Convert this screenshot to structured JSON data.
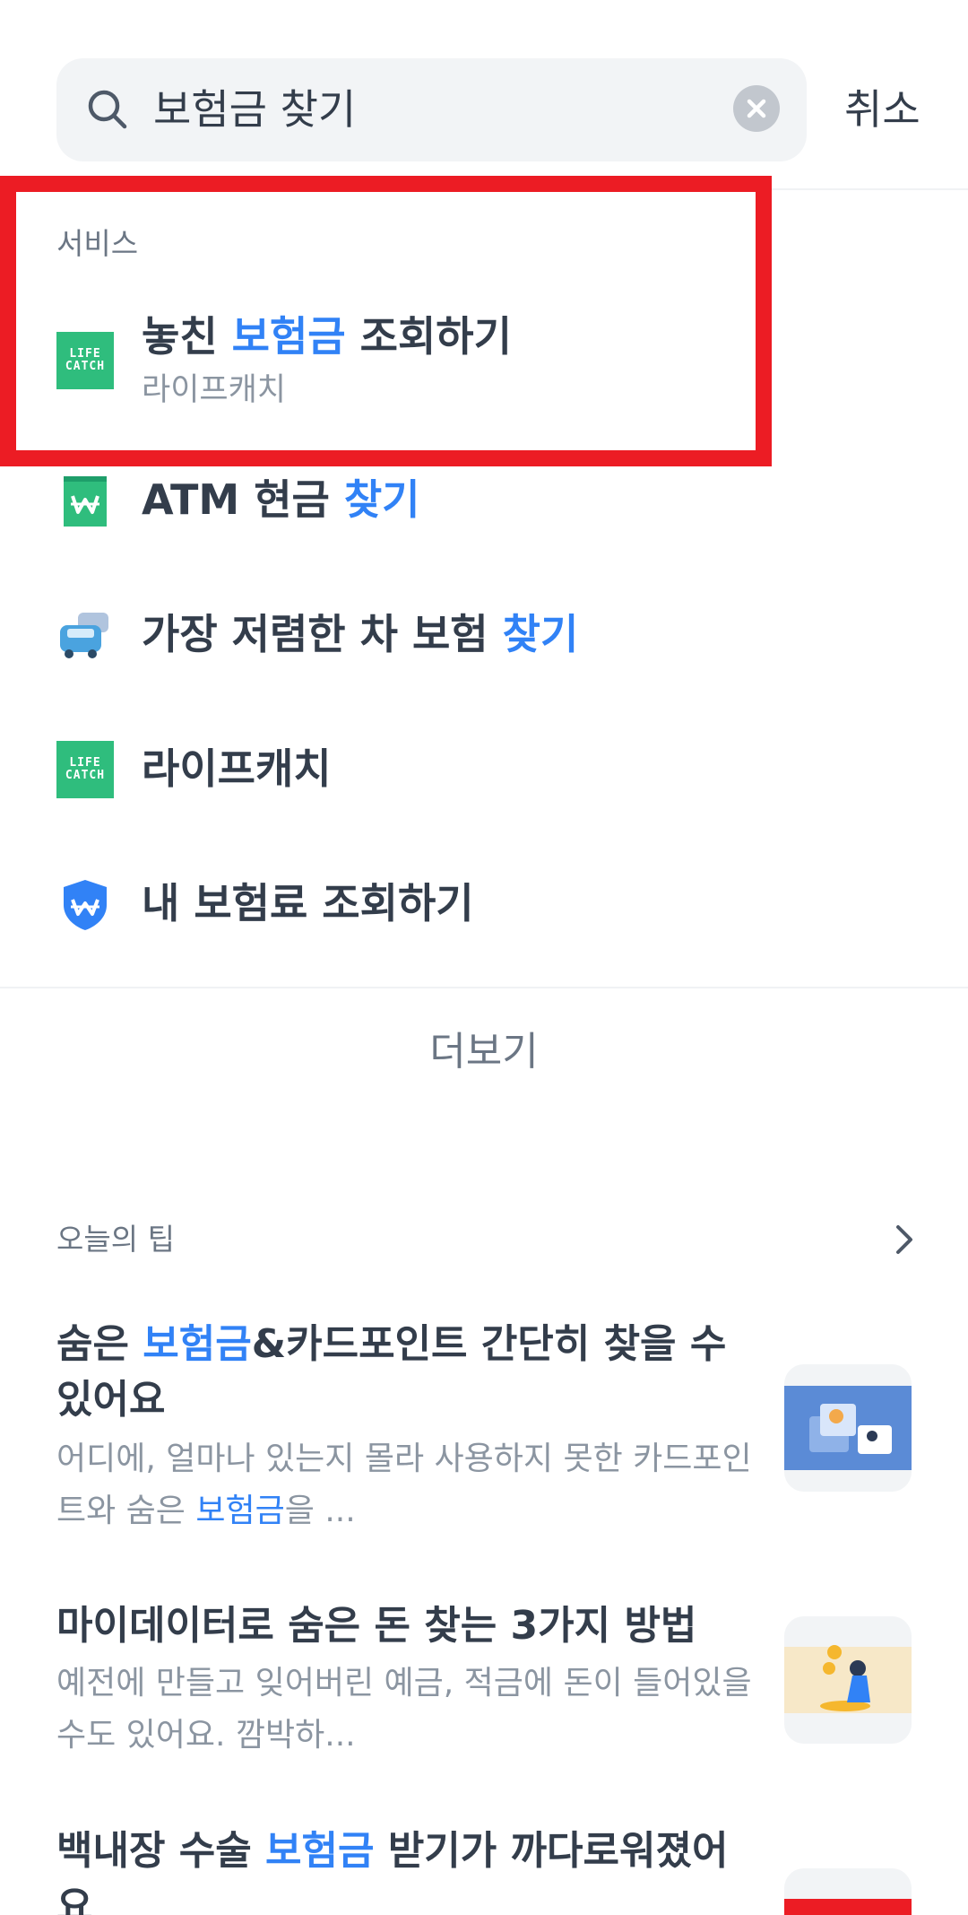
{
  "search": {
    "query": "보험금 찾기",
    "cancel_label": "취소"
  },
  "services": {
    "section_label": "서비스",
    "items": [
      {
        "title_pre": "놓친 ",
        "title_hl": "보험금",
        "title_post": " 조회하기",
        "subtitle": "라이프캐치",
        "icon": "lifecatch-icon"
      },
      {
        "title_pre": "ATM 현금 ",
        "title_hl": "찾기",
        "title_post": "",
        "icon": "atm-won-icon"
      },
      {
        "title_pre": "가장 저렴한 차 보험 ",
        "title_hl": "찾기",
        "title_post": "",
        "icon": "car-icon"
      },
      {
        "title_pre": "라이프캐치",
        "title_hl": "",
        "title_post": "",
        "icon": "lifecatch-icon"
      },
      {
        "title_pre": "내 보험료 조회하기",
        "title_hl": "",
        "title_post": "",
        "icon": "shield-won-icon"
      }
    ],
    "lifecatch_logo_text": "LIFE CATCH"
  },
  "more_label": "더보기",
  "tips": {
    "section_label": "오늘의 팁",
    "items": [
      {
        "title_pre": "숨은 ",
        "title_hl": "보험금",
        "title_post": "&카드포인트 간단히 찾을 수 있어요",
        "desc_pre": "어디에, 얼마나 있는지 몰라 사용하지 못한 카드포인트와 숨은 ",
        "desc_hl": "보험금",
        "desc_post": "을 ..."
      },
      {
        "title_pre": "마이데이터로 숨은 돈 찾는 3가지 방법",
        "title_hl": "",
        "title_post": "",
        "desc_pre": "예전에 만들고 잊어버린 예금, 적금에 돈이 들어있을 수도 있어요. 깜박하...",
        "desc_hl": "",
        "desc_post": ""
      },
      {
        "title_pre": "백내장 수술 ",
        "title_hl": "보험금",
        "title_post": " 받기가 까다로워졌어요",
        "desc_pre": "",
        "desc_hl": "",
        "desc_post": ""
      }
    ]
  },
  "colors": {
    "accent": "#3182f6",
    "highlight_border": "#ec1c24",
    "lifecatch_green": "#2fbd7d"
  }
}
